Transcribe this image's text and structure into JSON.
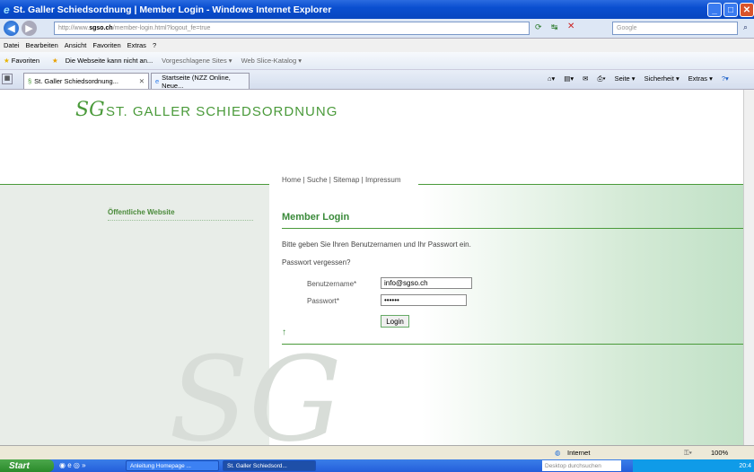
{
  "window": {
    "title": "St. Galler Schiedsordnung | Member Login - Windows Internet Explorer"
  },
  "address": {
    "url_prefix": "http://www.",
    "url_domain": "sgso.ch",
    "url_path": "/member-login.html?logout_fe=true",
    "search_placeholder": "Google"
  },
  "menu": [
    "Datei",
    "Bearbeiten",
    "Ansicht",
    "Favoriten",
    "Extras",
    "?"
  ],
  "favorites": {
    "label": "Favoriten",
    "items": [
      "Die Webseite kann nicht an...",
      "Vorgeschlagene Sites ▾",
      "Web Slice-Katalog ▾"
    ]
  },
  "tabs": [
    "St. Galler Schiedsordnung...",
    "Startseite (NZZ Online, Neue..."
  ],
  "command_bar": [
    "Seite ▾",
    "Sicherheit ▾",
    "Extras ▾"
  ],
  "site": {
    "logo_text": "ST. GALLER SCHIEDSORDNUNG",
    "logo_mark": "SG",
    "topnav": "Home | Suche | Sitemap | Impressum",
    "sidebar_link": "Öffentliche Website",
    "heading": "Member Login",
    "intro": "Bitte geben Sie Ihren Benutzernamen und Ihr Passwort ein.",
    "forgot": "Passwort vergessen?",
    "username_label": "Benutzername*",
    "username_value": "info@sgso.ch",
    "password_label": "Passwort*",
    "password_value": "••••••",
    "login_button": "Login",
    "back_to_top": "↑"
  },
  "status": {
    "zone": "Internet",
    "zoom": "100%"
  },
  "taskbar": {
    "start": "Start",
    "tasks": [
      "Anleitung Homepage ...",
      "St. Galler Schiedsord..."
    ],
    "search": "Desktop durchsuchen",
    "clock": "20:4"
  }
}
